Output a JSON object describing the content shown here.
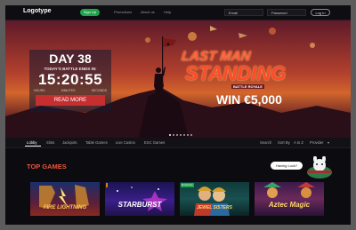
{
  "topbar": {
    "logo": "Logotype",
    "signup_label": "Sign Up",
    "nav": [
      "Promotions",
      "About us",
      "Help"
    ],
    "email_placeholder": "Email",
    "password_placeholder": "Password",
    "login_label": "Log In"
  },
  "hero": {
    "day": "DAY 38",
    "ends_label": "TODAY'S BATTLE ENDS IN:",
    "timer": "15:20:55",
    "units": [
      "HOURS",
      "MINUTES",
      "SECONDS"
    ],
    "read_more": "READ MORE",
    "headline_line1": "LAST MAN",
    "headline_line2": "STANDING",
    "subline": "BATTLE ROYALE",
    "prize": "WIN €5,000"
  },
  "categories": {
    "left": [
      "Lobby",
      "Slots",
      "Jackpots",
      "Table Games",
      "Live Casino",
      "ESC Games"
    ],
    "right": [
      "Search",
      "Sort By",
      "A to Z",
      "Provider"
    ]
  },
  "section": {
    "title": "TOP GAMES",
    "chat_label": "Having Luck?"
  },
  "games": [
    {
      "title": "FIRE LIGHTNING",
      "badge": ""
    },
    {
      "title": "STARBURST",
      "badge": ""
    },
    {
      "title": "JEWEL SISTERS",
      "badge": "Exclusive"
    },
    {
      "title": "Aztec Magic",
      "badge": ""
    }
  ],
  "colors": {
    "accent_green": "#1da34a",
    "accent_red": "#c62f2f",
    "section_title": "#e6573c"
  }
}
